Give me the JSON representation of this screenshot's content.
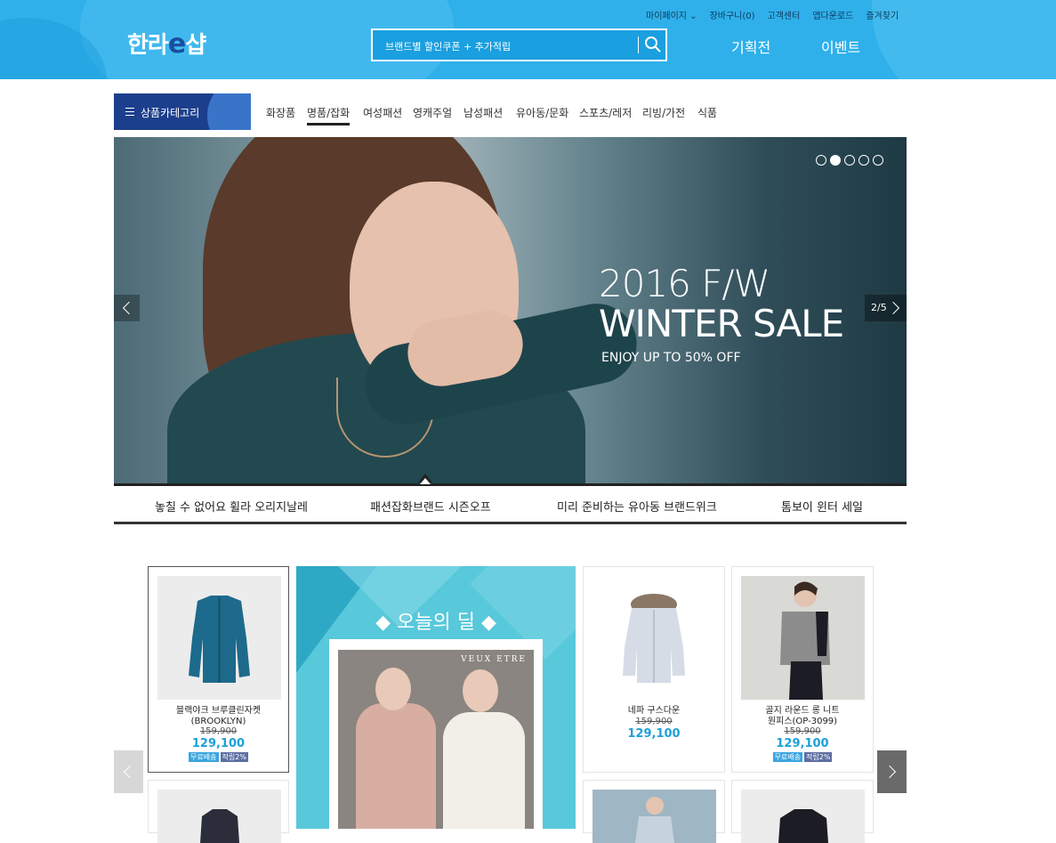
{
  "header": {
    "logo_main": "한라",
    "logo_e": "e",
    "logo_tail": "샵",
    "util_links": [
      "마이페이지 ⌄",
      "장바구니(0)",
      "고객센터",
      "앱다운로드",
      "즐겨찾기"
    ],
    "search_placeholder": "브랜드별 할인쿠폰 + 추가적립",
    "nav": [
      "기획전",
      "이벤트"
    ]
  },
  "category": {
    "button_label": "상품카테고리",
    "items": [
      "화장품",
      "명품/잡화",
      "여성패션",
      "영캐주얼",
      "남성패션",
      "유아동/문화",
      "스포츠/레저",
      "리빙/가전",
      "식품"
    ],
    "active_index": 1
  },
  "banner": {
    "headline1": "2016 F/W",
    "headline2": "WINTER SALE",
    "subline": "ENJOY UP TO 50% OFF",
    "counter": "2/5",
    "active_dot": 1,
    "dot_count": 5
  },
  "banner_tabs": [
    "놓칠 수 없어요 휠라 오리지날레",
    "패션잡화브랜드 시즌오프",
    "미리 준비하는 유아동 브랜드위크",
    "톰보이 윈터 세일"
  ],
  "deal": {
    "title": "◆ 오늘의 딜 ◆",
    "brand": "VEUX ETRE"
  },
  "products": [
    {
      "name1": "블랙야크 브루클린자켓",
      "name2": "(BROOKLYN)",
      "old_price": "159,900",
      "price": "129,100",
      "badges": [
        "무료배송",
        "적립2%"
      ]
    },
    {
      "name1": "네파 구스다운",
      "name2": "",
      "old_price": "159,900",
      "price": "129,100",
      "badges": []
    },
    {
      "name1": "골지 라운드 롱 니트",
      "name2": "원피스(OP-3099)",
      "old_price": "159,900",
      "price": "129,100",
      "badges": [
        "무료배송",
        "적립2%"
      ]
    }
  ],
  "colors": {
    "header_blue": "#2fb0ea",
    "category_navy": "#1c3f8d",
    "price_blue": "#1ea0d9",
    "deal_teal": "#58c8db"
  }
}
